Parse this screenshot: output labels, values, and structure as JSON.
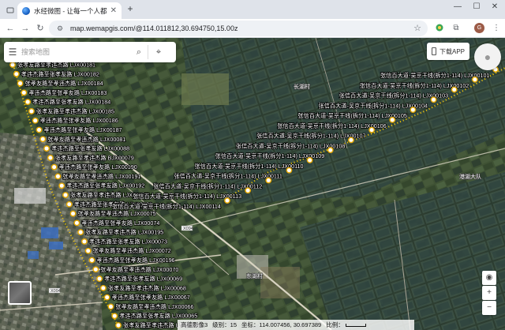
{
  "browser": {
    "tab_title": "水经微图 - 让每一个人都有自己",
    "url": "map.wemapgis.com/@114.011812,30.694750,15.00z"
  },
  "map": {
    "search_placeholder": "搜索地图",
    "download_label": "下载APP",
    "place_labels": [
      "长湖村",
      "港湖大队",
      "东湖村"
    ],
    "road_labels": [
      "X094",
      "X094"
    ],
    "status": {
      "scale_name": "高德影像3",
      "level_label": "级别：",
      "level_value": "15",
      "coords_label": "坐标：",
      "coords_value": "114.007456, 30.697389",
      "scale_label": "比例："
    },
    "markers_left": [
      {
        "text": "张孝友路至孝违杰路 LJX00181"
      },
      {
        "text": "孝违杰路至张孝友路 LJX00182"
      },
      {
        "text": "张孝友路至孝违杰路 LJX00184"
      },
      {
        "text": "孝违杰路至张孝友路 LJX00183"
      },
      {
        "text": "孝违杰路至张孝友路 LJX00184"
      },
      {
        "text": "张孝友路至孝违杰路 LJX00185"
      },
      {
        "text": "孝违杰路至张孝友路 LJX00186"
      },
      {
        "text": "孝违杰路至张孝友路 LJX00187"
      },
      {
        "text": "张孝友路至孝违杰路 LJX00081"
      },
      {
        "text": "孝违杰路至张孝友路 LJX00088"
      },
      {
        "text": "张孝友路至孝违杰路 BJX00079"
      },
      {
        "text": "孝违杰路至张孝友路 LJX00190"
      },
      {
        "text": "张孝友路至孝违杰路 LJX00191"
      },
      {
        "text": "孝违杰路至张孝友路 LJX00192"
      },
      {
        "text": "张孝友路至孝违杰路 LJX00075"
      },
      {
        "text": "孝违杰路至张孝友路 LJX00193"
      },
      {
        "text": "张孝友路至孝违杰路 LJX00075"
      },
      {
        "text": "孝违杰路至张孝友路 LJX00074"
      },
      {
        "text": "张孝友路至孝违杰路 LJX00195"
      },
      {
        "text": "孝违杰路至张孝友路 LJX00073"
      },
      {
        "text": "张孝友路至孝违杰路 LJX00072"
      },
      {
        "text": "孝违杰路至张孝友路 LJX00196"
      },
      {
        "text": "张孝友路至孝违杰路 LJX00070"
      },
      {
        "text": "孝违杰路至张孝友路 LJX00069"
      },
      {
        "text": "张孝友路至孝违杰路 LJX00068"
      },
      {
        "text": "孝违杰路至张孝友路 LJX00067"
      },
      {
        "text": "张孝友路至孝违杰路 LJX00066"
      },
      {
        "text": "孝违杰路至张孝友路 LJX00065"
      },
      {
        "text": "张孝友路至孝违杰路 LJX00064"
      }
    ],
    "markers_right": [
      {
        "text": "张信百大道-吴京干线(拆分1-114) LJX00101"
      },
      {
        "text": "张信百大道-吴京干线(拆分1-114) LJX00102"
      },
      {
        "text": "张信百大道-吴京干线(拆分1-114) LJX00103"
      },
      {
        "text": "张信百大道-吴京干线(拆分1-114) LJX00104"
      },
      {
        "text": "张信百大道-吴京干线(拆分1-114) LJX00105"
      },
      {
        "text": "张信百大道-吴京干线(拆分1-114) LJX00106"
      },
      {
        "text": "张信百大道-吴京干线(拆分1-114) LJX00107"
      },
      {
        "text": "张信百大道-吴京干线(拆分1-114) LJX00108"
      },
      {
        "text": "张信百大道-吴京干线(拆分1-114) LJX00109"
      },
      {
        "text": "张信百大道-吴京干线(拆分1-114) LJX00110"
      },
      {
        "text": "张信百大道-吴京干线(拆分1-114) LJX00111"
      },
      {
        "text": "张信百大道-吴京干线(拆分1-114) LJX00112"
      },
      {
        "text": "张信百大道-吴京干线(拆分1-114) LJX00113"
      },
      {
        "text": "张信百大道-吴京干线(拆分1-114) LJX00114"
      }
    ]
  }
}
